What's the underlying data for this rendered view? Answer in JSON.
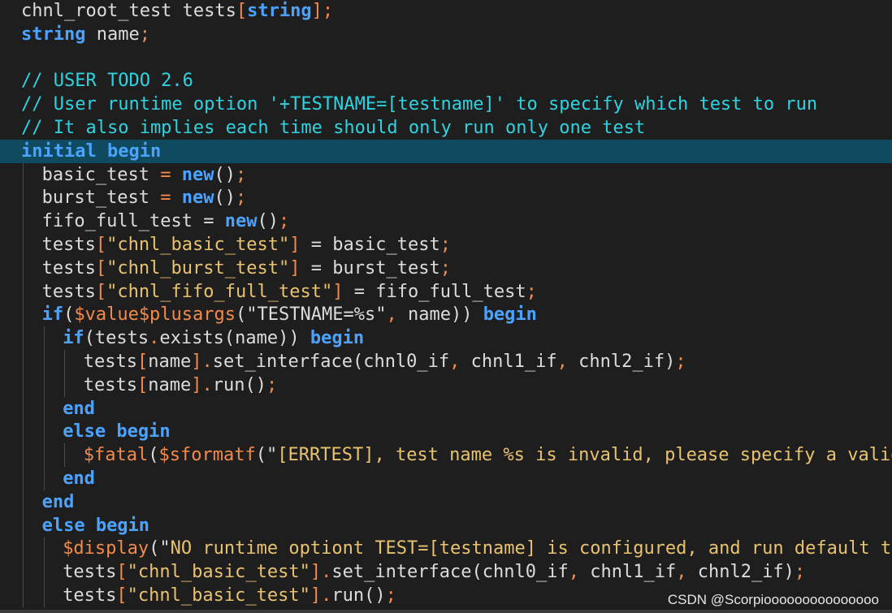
{
  "editor": {
    "lines": [
      {
        "indent": 0,
        "tokens": [
          [
            "plain",
            "chnl_root_test tests"
          ],
          [
            "punc",
            "["
          ],
          [
            "kw",
            "string"
          ],
          [
            "punc",
            "];"
          ]
        ]
      },
      {
        "indent": 0,
        "tokens": [
          [
            "kw",
            "string"
          ],
          [
            "plain",
            " name"
          ],
          [
            "punc",
            ";"
          ]
        ]
      },
      {
        "indent": 0,
        "tokens": []
      },
      {
        "indent": 0,
        "tokens": [
          [
            "com",
            "// USER TODO 2.6"
          ]
        ]
      },
      {
        "indent": 0,
        "tokens": [
          [
            "com",
            "// User runtime option '+TESTNAME=[testname]' to specify which test to run"
          ]
        ]
      },
      {
        "indent": 0,
        "tokens": [
          [
            "com",
            "// It also implies each time should only run only one test"
          ]
        ]
      },
      {
        "indent": 0,
        "current": true,
        "tokens": [
          [
            "kw",
            "initial begin"
          ]
        ]
      },
      {
        "indent": 1,
        "tokens": [
          [
            "plain",
            "basic_test "
          ],
          [
            "punc",
            "="
          ],
          [
            "plain",
            " "
          ],
          [
            "kw",
            "new"
          ],
          [
            "plain",
            "()"
          ],
          [
            "punc",
            ";"
          ]
        ]
      },
      {
        "indent": 1,
        "tokens": [
          [
            "plain",
            "burst_test "
          ],
          [
            "punc",
            "="
          ],
          [
            "plain",
            " "
          ],
          [
            "kw",
            "new"
          ],
          [
            "plain",
            "()"
          ],
          [
            "punc",
            ";"
          ]
        ]
      },
      {
        "indent": 1,
        "tokens": [
          [
            "plain",
            "fifo_full_test = "
          ],
          [
            "kw",
            "new"
          ],
          [
            "plain",
            "()"
          ],
          [
            "punc",
            ";"
          ]
        ]
      },
      {
        "indent": 1,
        "tokens": [
          [
            "plain",
            "tests"
          ],
          [
            "punc",
            "["
          ],
          [
            "str",
            "\"chnl_basic_test\""
          ],
          [
            "punc",
            "]"
          ],
          [
            "plain",
            " = basic_test"
          ],
          [
            "punc",
            ";"
          ]
        ]
      },
      {
        "indent": 1,
        "tokens": [
          [
            "plain",
            "tests"
          ],
          [
            "punc",
            "["
          ],
          [
            "str",
            "\"chnl_burst_test\""
          ],
          [
            "punc",
            "]"
          ],
          [
            "plain",
            " = burst_test"
          ],
          [
            "punc",
            ";"
          ]
        ]
      },
      {
        "indent": 1,
        "tokens": [
          [
            "plain",
            "tests"
          ],
          [
            "punc",
            "["
          ],
          [
            "str",
            "\"chnl_fifo_full_test\""
          ],
          [
            "punc",
            "]"
          ],
          [
            "plain",
            " = fifo_full_test"
          ],
          [
            "punc",
            ";"
          ]
        ]
      },
      {
        "indent": 1,
        "tokens": [
          [
            "kw",
            "if"
          ],
          [
            "plain",
            "("
          ],
          [
            "sys",
            "$value$plusargs"
          ],
          [
            "plain",
            "(\"TESTNAME=%s\""
          ],
          [
            "punc",
            ","
          ],
          [
            "plain",
            " name)) "
          ],
          [
            "kw",
            "begin"
          ]
        ]
      },
      {
        "indent": 2,
        "tokens": [
          [
            "kw",
            "if"
          ],
          [
            "plain",
            "(tests"
          ],
          [
            "punc",
            "."
          ],
          [
            "plain",
            "exists(name)) "
          ],
          [
            "kw",
            "begin"
          ]
        ]
      },
      {
        "indent": 3,
        "tokens": [
          [
            "plain",
            "tests"
          ],
          [
            "punc",
            "["
          ],
          [
            "plain",
            "name"
          ],
          [
            "punc",
            "]."
          ],
          [
            "plain",
            "set_interface(chnl0_if"
          ],
          [
            "punc",
            ","
          ],
          [
            "plain",
            " chnl1_if"
          ],
          [
            "punc",
            ","
          ],
          [
            "plain",
            " chnl2_if)"
          ],
          [
            "punc",
            ";"
          ]
        ]
      },
      {
        "indent": 3,
        "tokens": [
          [
            "plain",
            "tests"
          ],
          [
            "punc",
            "["
          ],
          [
            "plain",
            "name"
          ],
          [
            "punc",
            "]."
          ],
          [
            "plain",
            "run()"
          ],
          [
            "punc",
            ";"
          ]
        ]
      },
      {
        "indent": 2,
        "tokens": [
          [
            "kw",
            "end"
          ]
        ]
      },
      {
        "indent": 2,
        "tokens": [
          [
            "kw",
            "else begin"
          ]
        ]
      },
      {
        "indent": 3,
        "tokens": [
          [
            "sys",
            "$fatal"
          ],
          [
            "plain",
            "("
          ],
          [
            "sys",
            "$sformatf"
          ],
          [
            "plain",
            "(\""
          ],
          [
            "str",
            "[ERRTEST], test name %s is invalid, please specify a valid n"
          ]
        ]
      },
      {
        "indent": 2,
        "tokens": [
          [
            "kw",
            "end"
          ]
        ]
      },
      {
        "indent": 1,
        "tokens": [
          [
            "kw",
            "end"
          ]
        ]
      },
      {
        "indent": 1,
        "tokens": [
          [
            "kw",
            "else begin"
          ]
        ]
      },
      {
        "indent": 2,
        "tokens": [
          [
            "sys",
            "$display"
          ],
          [
            "plain",
            "(\""
          ],
          [
            "str",
            "NO runtime optiont TEST=[testname] is configured, and run default test"
          ]
        ]
      },
      {
        "indent": 2,
        "tokens": [
          [
            "plain",
            "tests"
          ],
          [
            "punc",
            "["
          ],
          [
            "str",
            "\"chnl_basic_test\""
          ],
          [
            "punc",
            "]."
          ],
          [
            "plain",
            "set_interface(chnl0_if"
          ],
          [
            "punc",
            ","
          ],
          [
            "plain",
            " chnl1_if"
          ],
          [
            "punc",
            ","
          ],
          [
            "plain",
            " chnl2_if)"
          ],
          [
            "punc",
            ";"
          ]
        ]
      },
      {
        "indent": 2,
        "tokens": [
          [
            "plain",
            "tests"
          ],
          [
            "punc",
            "["
          ],
          [
            "str",
            "\"chnl_basic_test\""
          ],
          [
            "punc",
            "]."
          ],
          [
            "plain",
            "run()"
          ],
          [
            "punc",
            ";"
          ]
        ]
      }
    ]
  },
  "watermark": "CSDN @Scorpiooooooooooooooo",
  "colors": {
    "background": "#1e1e1e",
    "current_line": "#0f4a5e",
    "keyword": "#4ba3ff",
    "string": "#e8c26e",
    "punctuation": "#f28a4b",
    "comment": "#2fd3e0",
    "plain": "#dcdcdc"
  }
}
